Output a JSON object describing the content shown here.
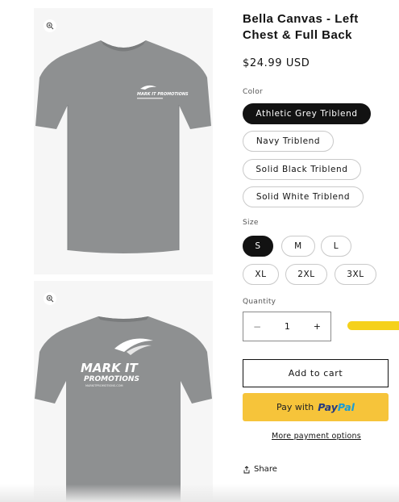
{
  "product": {
    "title": "Bella Canvas - Left Chest & Full Back",
    "price": "$24.99 USD"
  },
  "gallery": {
    "images": [
      {
        "alt": "Front of grey t-shirt",
        "logo_text": "MARK IT PROMOTIONS"
      },
      {
        "alt": "Back of grey t-shirt",
        "logo_text_1": "MARK IT",
        "logo_text_2": "PROMOTIONS",
        "logo_url": "MARKITPROMOTIONS.COM"
      }
    ]
  },
  "color": {
    "label": "Color",
    "options": [
      "Athletic Grey Triblend",
      "Navy Triblend",
      "Solid Black Triblend",
      "Solid White Triblend"
    ],
    "selected": "Athletic Grey Triblend"
  },
  "size": {
    "label": "Size",
    "options": [
      "S",
      "M",
      "L",
      "XL",
      "2XL",
      "3XL"
    ],
    "selected": "S"
  },
  "quantity": {
    "label": "Quantity",
    "value": "1",
    "minus": "−",
    "plus": "+"
  },
  "buttons": {
    "add_to_cart": "Add to cart",
    "pay_with": "Pay with",
    "paypal_pay": "Pay",
    "paypal_pal": "Pal",
    "more_payment": "More payment options",
    "share": "Share"
  },
  "colors": {
    "selected_pill": "#121212",
    "paypal_bg": "#f6c43a",
    "accent_yellow": "#f5d11b",
    "shirt_grey": "#8e9091"
  },
  "icons": [
    "zoom-icon",
    "share-icon"
  ]
}
